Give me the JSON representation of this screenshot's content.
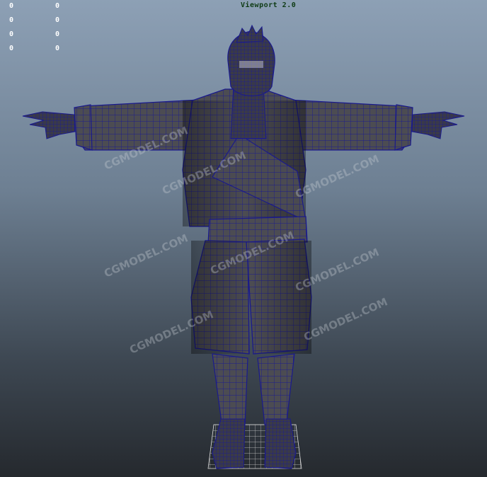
{
  "viewport": {
    "label": "Viewport 2.0",
    "wireframe_color": "#1a1a8c",
    "mesh_color": "#4a4a4e",
    "background_top": "#8da0b5",
    "background_bottom": "#25292e"
  },
  "hud": {
    "rows": [
      {
        "a": "0",
        "b": "0"
      },
      {
        "a": "0",
        "b": "0"
      },
      {
        "a": "0",
        "b": "0"
      },
      {
        "a": "0",
        "b": "0"
      }
    ]
  },
  "watermark": {
    "text": "CGMODEL.COM"
  },
  "icons": {
    "model": "character-tpose-model-icon",
    "grid": "ground-grid-icon"
  }
}
